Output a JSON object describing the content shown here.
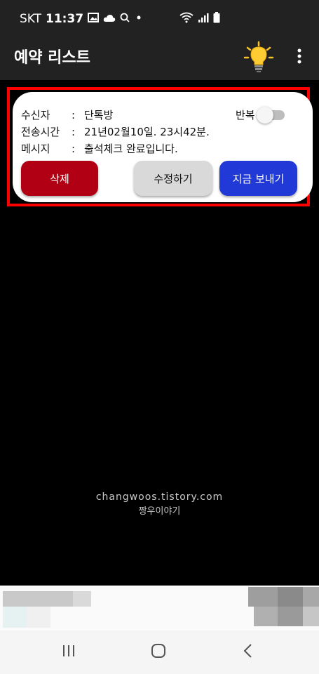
{
  "status_bar": {
    "carrier": "SKT",
    "time": "11:37",
    "icons": [
      "image-icon",
      "cloud-icon",
      "search-icon",
      "dot-icon",
      "wifi-icon",
      "signal-icon",
      "battery-icon"
    ]
  },
  "app_bar": {
    "title": "예약 리스트",
    "icons": [
      "lightbulb-icon",
      "more-vert-icon"
    ]
  },
  "reservation": {
    "recipient_label": "수신자",
    "recipient_value": "단톡방",
    "time_label": "전송시간",
    "time_value": "21년02월10일. 23시42분.",
    "message_label": "메시지",
    "message_value": "출석체크 완료입니다.",
    "separator": ":",
    "repeat_label": "반복",
    "repeat_enabled": false,
    "delete_label": "삭제",
    "edit_label": "수정하기",
    "send_now_label": "지금 보내기"
  },
  "watermark": {
    "line1": "changwoos.tistory.com",
    "line2": "짱우이야기"
  },
  "nav_bar": {
    "icons": [
      "recent-apps-icon",
      "home-icon",
      "back-icon"
    ]
  },
  "colors": {
    "highlight": "#ff0000",
    "delete": "#b10014",
    "edit": "#d9d9d9",
    "send": "#2139d6",
    "appbar": "#222222"
  }
}
